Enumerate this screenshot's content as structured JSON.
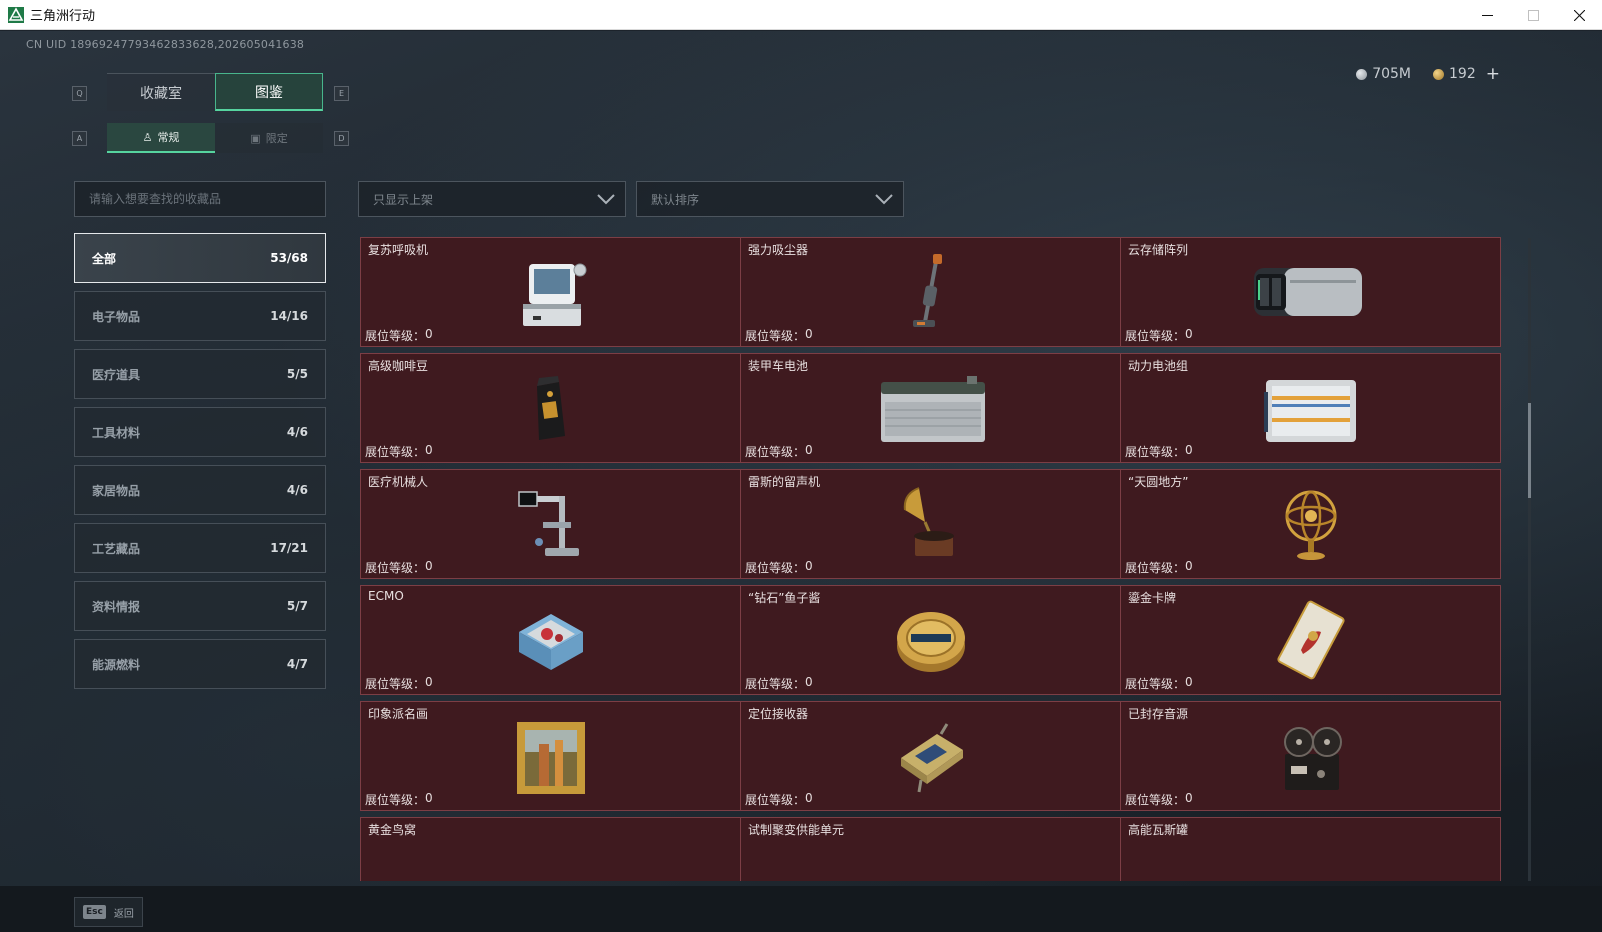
{
  "window": {
    "title": "三角洲行动"
  },
  "uid_text": "CN UID 18969247793462833628,202605041638",
  "currency": [
    {
      "icon": "silver-coin-icon",
      "value": "705M"
    },
    {
      "icon": "gold-coin-icon",
      "value": "192"
    }
  ],
  "keyhints": {
    "q": "Q",
    "e": "E",
    "a": "A",
    "d": "D",
    "esc": "Esc"
  },
  "main_tabs": [
    {
      "label": "收藏室",
      "active": false
    },
    {
      "label": "图鉴",
      "active": true
    }
  ],
  "sub_tabs": [
    {
      "label": "常规",
      "icon": "figure-icon",
      "active": true
    },
    {
      "label": "限定",
      "icon": "picture-icon",
      "active": false
    }
  ],
  "search": {
    "placeholder": "请输入想要查找的收藏品"
  },
  "filters": {
    "shelf_filter": "只显示上架",
    "sort": "默认排序"
  },
  "categories": [
    {
      "label": "全部",
      "count": "53/68",
      "active": true
    },
    {
      "label": "电子物品",
      "count": "14/16"
    },
    {
      "label": "医疗道具",
      "count": "5/5"
    },
    {
      "label": "工具材料",
      "count": "4/6"
    },
    {
      "label": "家居物品",
      "count": "4/6"
    },
    {
      "label": "工艺藏品",
      "count": "17/21"
    },
    {
      "label": "资料情报",
      "count": "5/7"
    },
    {
      "label": "能源燃料",
      "count": "4/7"
    }
  ],
  "level_label": "展位等级：",
  "items": [
    {
      "name": "复苏呼吸机",
      "level": "0",
      "icon": "ventilator-icon"
    },
    {
      "name": "强力吸尘器",
      "level": "0",
      "icon": "vacuum-cleaner-icon"
    },
    {
      "name": "云存储阵列",
      "level": "0",
      "icon": "storage-array-icon"
    },
    {
      "name": "高级咖啡豆",
      "level": "0",
      "icon": "coffee-bag-icon"
    },
    {
      "name": "装甲车电池",
      "level": "0",
      "icon": "car-battery-icon"
    },
    {
      "name": "动力电池组",
      "level": "0",
      "icon": "battery-pack-icon"
    },
    {
      "name": "医疗机械人",
      "level": "0",
      "icon": "medical-robot-icon"
    },
    {
      "name": "雷斯的留声机",
      "level": "0",
      "icon": "gramophone-icon"
    },
    {
      "name": "“天圆地方”",
      "level": "0",
      "icon": "armillary-sphere-icon"
    },
    {
      "name": "ECMO",
      "level": "0",
      "icon": "ecmo-machine-icon"
    },
    {
      "name": "“钻石”鱼子酱",
      "level": "0",
      "icon": "caviar-tin-icon"
    },
    {
      "name": "鎏金卡牌",
      "level": "0",
      "icon": "gold-card-icon"
    },
    {
      "name": "印象派名画",
      "level": "0",
      "icon": "framed-painting-icon"
    },
    {
      "name": "定位接收器",
      "level": "0",
      "icon": "receiver-icon"
    },
    {
      "name": "已封存音源",
      "level": "0",
      "icon": "reel-recorder-icon"
    },
    {
      "name": "黄金鸟窝",
      "level": "",
      "icon": ""
    },
    {
      "name": "试制聚变供能单元",
      "level": "",
      "icon": ""
    },
    {
      "name": "高能瓦斯罐",
      "level": "",
      "icon": ""
    }
  ],
  "back_label": "返回"
}
